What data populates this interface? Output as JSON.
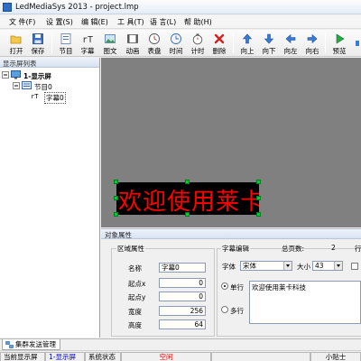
{
  "window": {
    "title": "LedMediaSys 2013 - project.lmp"
  },
  "menu": [
    {
      "label": "文 件(F)"
    },
    {
      "label": "设 置(S)"
    },
    {
      "label": "编 辑(E)"
    },
    {
      "label": "工 具(T)"
    },
    {
      "label": "语 言(L)"
    },
    {
      "label": "帮 助(H)"
    }
  ],
  "toolbar": [
    {
      "label": "打开",
      "icon": "folder-icon"
    },
    {
      "label": "保存",
      "icon": "save-icon"
    },
    {
      "label": "节目",
      "icon": "program-icon"
    },
    {
      "label": "字幕",
      "icon": "text-icon"
    },
    {
      "label": "图文",
      "icon": "picture-text-icon"
    },
    {
      "label": "动画",
      "icon": "animation-icon"
    },
    {
      "label": "表盘",
      "icon": "clock-dial-icon"
    },
    {
      "label": "时间",
      "icon": "time-icon"
    },
    {
      "label": "计时",
      "icon": "timer-icon"
    },
    {
      "label": "删除",
      "icon": "delete-icon"
    },
    {
      "label": "向上",
      "icon": "arrow-up-icon"
    },
    {
      "label": "向下",
      "icon": "arrow-down-icon"
    },
    {
      "label": "向左",
      "icon": "arrow-left-icon"
    },
    {
      "label": "向右",
      "icon": "arrow-right-icon"
    },
    {
      "label": "预览",
      "icon": "play-icon"
    }
  ],
  "tree": {
    "header": "显示屏列表",
    "screen": "1-显示屏",
    "program": "节目0",
    "subtitle": "字幕0"
  },
  "canvas": {
    "text": "欢迎使用莱卡科技"
  },
  "properties": {
    "header": "对象属性",
    "region": {
      "title": "区域属性",
      "name_label": "名称",
      "name_value": "字幕0",
      "x_label": "起点x",
      "x_value": "0",
      "y_label": "起点y",
      "y_value": "0",
      "width_label": "宽度",
      "width_value": "256",
      "height_label": "高度",
      "height_value": "64"
    },
    "subtitle": {
      "title": "字幕编辑",
      "total_pages_label": "总页数:",
      "total_pages_value": "2",
      "extra_label": "行",
      "font_label": "字体",
      "font_value": "宋体",
      "size_label": "大小",
      "size_value": "43",
      "single_line_label": "单行",
      "multi_line_label": "多行",
      "content": "欢迎使用莱卡科技"
    }
  },
  "bottom_tab": {
    "label": "集群发送管理"
  },
  "status": {
    "current_screen_label": "当前显示屏",
    "current_screen_value": "1-显示屏",
    "system_status_label": "系统状态",
    "system_status_value": "空闲",
    "tip_label": "小贴士"
  },
  "colors": {
    "canvas_bg": "#808080",
    "led_text": "#ff0000",
    "status_idle": "#ff0000",
    "status_screen": "#0000cc"
  }
}
